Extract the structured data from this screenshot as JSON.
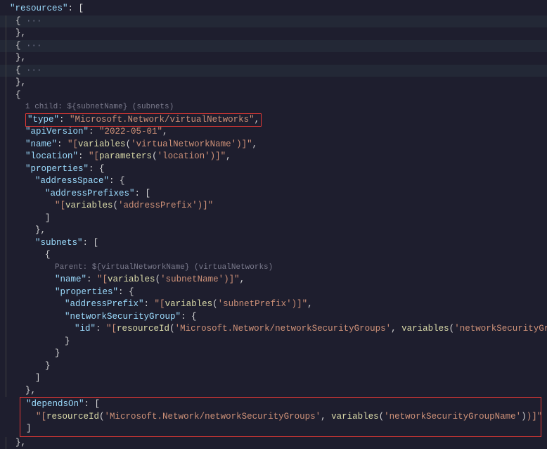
{
  "code": {
    "resources_key": "\"resources\"",
    "colon_bracket": ": [",
    "open_brace": "{",
    "collapsed": " ···",
    "close_brace_comma": "},",
    "close_brace": "}",
    "open_brace_only": "{",
    "hint1": "1 child: ${subnetName} (subnets)",
    "type_key": "\"type\"",
    "type_val": "\"Microsoft.Network/virtualNetworks\"",
    "comma": ",",
    "apiVersion_key": "\"apiVersion\"",
    "apiVersion_val": "\"2022-05-01\"",
    "name_key": "\"name\"",
    "name_val_open": "\"[",
    "variables_fn": "variables",
    "name_val_arg": "'virtualNetworkName'",
    "name_val_close": ")]\"",
    "location_key": "\"location\"",
    "parameters_fn": "parameters",
    "location_arg": "'location'",
    "properties_key": "\"properties\"",
    "colon_brace": ": {",
    "addressSpace_key": "\"addressSpace\"",
    "addressPrefixes_key": "\"addressPrefixes\"",
    "colon_sqbracket": ": [",
    "addressPrefix_arg": "'addressPrefix'",
    "close_sq": "]",
    "subnets_key": "\"subnets\"",
    "hint2": "Parent: ${virtualNetworkName} (virtualNetworks)",
    "subnet_name_arg": "'subnetName'",
    "addressPrefix_key": "\"addressPrefix\"",
    "subnetPrefix_arg": "'subnetPrefix'",
    "nsg_key": "\"networkSecurityGroup\"",
    "id_key": "\"id\"",
    "resourceId_fn": "resourceId",
    "nsg_type": "'Microsoft.Network/networkSecurityGroups'",
    "nsg_name_arg": "'networkSecurityGroupName'",
    "dependsOn_key": "\"dependsOn\"",
    "colon": ": "
  }
}
